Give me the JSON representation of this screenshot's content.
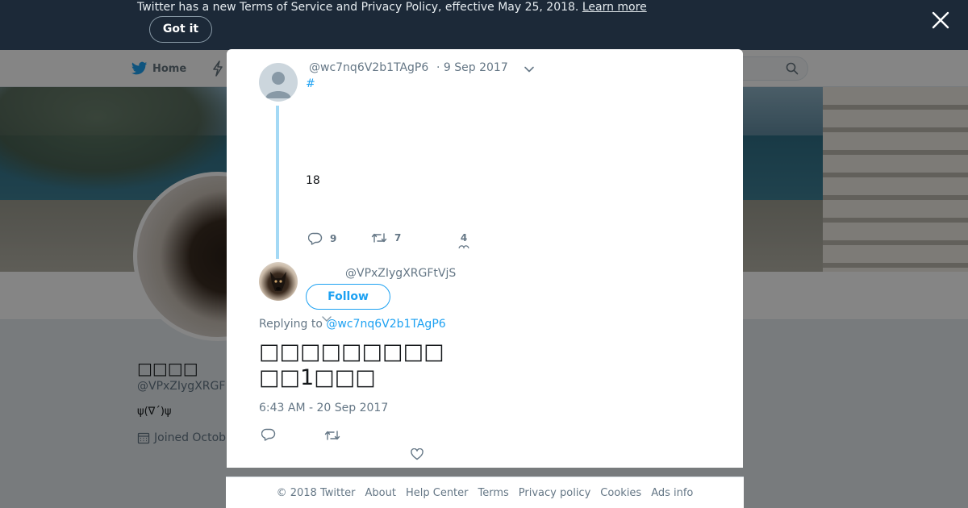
{
  "banner": {
    "text": "Twitter has a new Terms of Service and Privacy Policy, effective May 25, 2018.",
    "link_label": "Learn more",
    "got_it_label": "Got it"
  },
  "nav": {
    "home_label": "Home"
  },
  "profile": {
    "name": "□□□□",
    "handle": "@VPxZIygXRGF",
    "bio": "ψ(∇´)ψ",
    "joined": "Joined Octob"
  },
  "modal": {
    "parent_tweet": {
      "handle": "@wc7nq6V2b1TAgP6",
      "date": "· 9 Sep 2017",
      "hashtag": "#",
      "text": "18",
      "replies": "9",
      "retweets": "7",
      "likes": "4"
    },
    "main_tweet": {
      "handle": "@VPxZIygXRGFtVjS",
      "follow_label": "Follow",
      "replying_prefix": "Replying to",
      "replying_to": "@wc7nq6V2b1TAgP6",
      "text_line1": "□□□□□□□□□",
      "text_line2": "□□1□□□",
      "timestamp": "6:43 AM - 20 Sep 2017"
    }
  },
  "footer": {
    "copyright": "© 2018 Twitter",
    "links": [
      "About",
      "Help Center",
      "Terms",
      "Privacy policy",
      "Cookies",
      "Ads info"
    ]
  },
  "colors": {
    "accent": "#1da1f2",
    "banner_bg": "#1c2938",
    "thread_line": "#a4d9f5",
    "muted_text": "#657786"
  }
}
